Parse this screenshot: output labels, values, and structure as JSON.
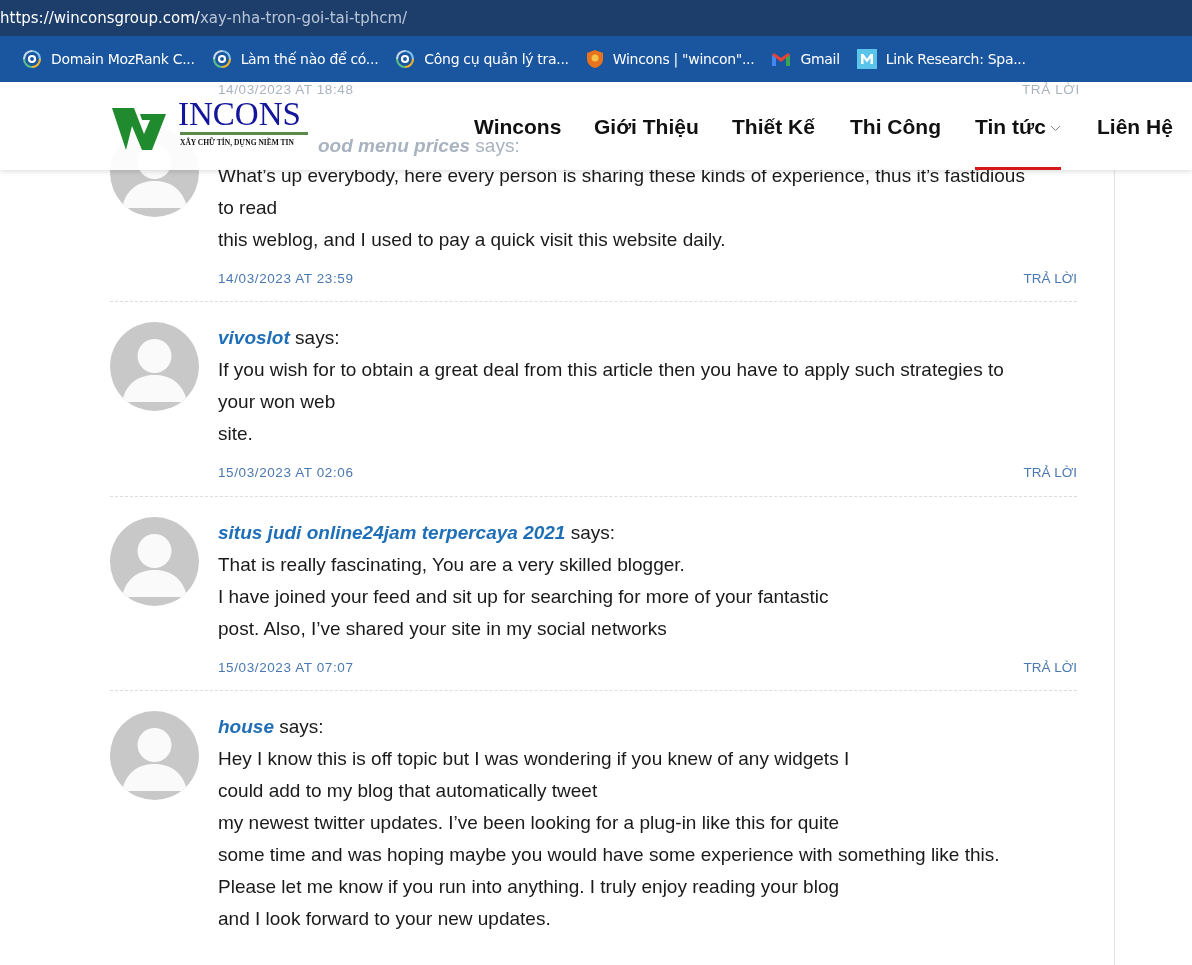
{
  "browser": {
    "url_host": "https://winconsgroup.com/",
    "url_path": "xay-nha-tron-goi-tai-tphcm/",
    "bookmarks": [
      {
        "kind": "swirl",
        "label": "Domain MozRank C..."
      },
      {
        "kind": "swirl",
        "label": "Làm thế nào để có..."
      },
      {
        "kind": "swirl",
        "label": "Công cụ quản lý tra..."
      },
      {
        "kind": "shield",
        "label": "Wincons | \"wincon\"..."
      },
      {
        "kind": "mail",
        "label": "Gmail"
      },
      {
        "kind": "m",
        "label": "Link Research: Spa..."
      }
    ]
  },
  "header": {
    "logo_text": "INCONS",
    "logo_tagline": "XÂY CHỮ TÍN, DỰNG NIỀM TIN",
    "nav": [
      {
        "label": "Wincons",
        "selected": false,
        "dropdown": false
      },
      {
        "label": "Giới Thiệu",
        "selected": false,
        "dropdown": false
      },
      {
        "label": "Thiết Kế",
        "selected": false,
        "dropdown": false
      },
      {
        "label": "Thi Công",
        "selected": false,
        "dropdown": false
      },
      {
        "label": "Tin tức",
        "selected": true,
        "dropdown": true
      },
      {
        "label": "Liên Hệ",
        "selected": false,
        "dropdown": false
      }
    ]
  },
  "hidden_meta": {
    "date": "14/03/2023 AT 18:48",
    "reply": "TRẢ LỜI",
    "author": "ood menu prices",
    "says": "says:"
  },
  "comments": [
    {
      "lines": [
        "What’s up everybody, here every person is sharing these kinds of experience, thus it’s fastidious to read",
        "this weblog, and I used to pay a quick visit this website daily."
      ],
      "date": "14/03/2023 AT 23:59",
      "reply": "TRẢ LỜI"
    },
    {
      "author": "vivoslot",
      "says": "says:",
      "lines": [
        "If you wish for to obtain a great deal from this article then you have to apply such strategies to your won web",
        "site."
      ],
      "date": "15/03/2023 AT 02:06",
      "reply": "TRẢ LỜI"
    },
    {
      "author": "situs judi online24jam terpercaya 2021",
      "says": "says:",
      "lines": [
        "That is really fascinating, You are a very skilled blogger.",
        "I have joined your feed and sit up for searching for more of your fantastic",
        "post. Also, I’ve shared your site in my social networks"
      ],
      "date": "15/03/2023 AT 07:07",
      "reply": "TRẢ LỜI"
    },
    {
      "author": "house",
      "says": "says:",
      "lines": [
        "Hey I know this is off topic but I was wondering if you knew of any widgets I",
        "could add to my blog that automatically tweet",
        "my newest twitter updates. I’ve been looking for a plug-in like this for quite",
        "some time and was hoping maybe you would have some experience with something like this.",
        "Please let me know if you run into anything. I truly enjoy reading your blog",
        "and I look forward to your new updates."
      ]
    }
  ]
}
